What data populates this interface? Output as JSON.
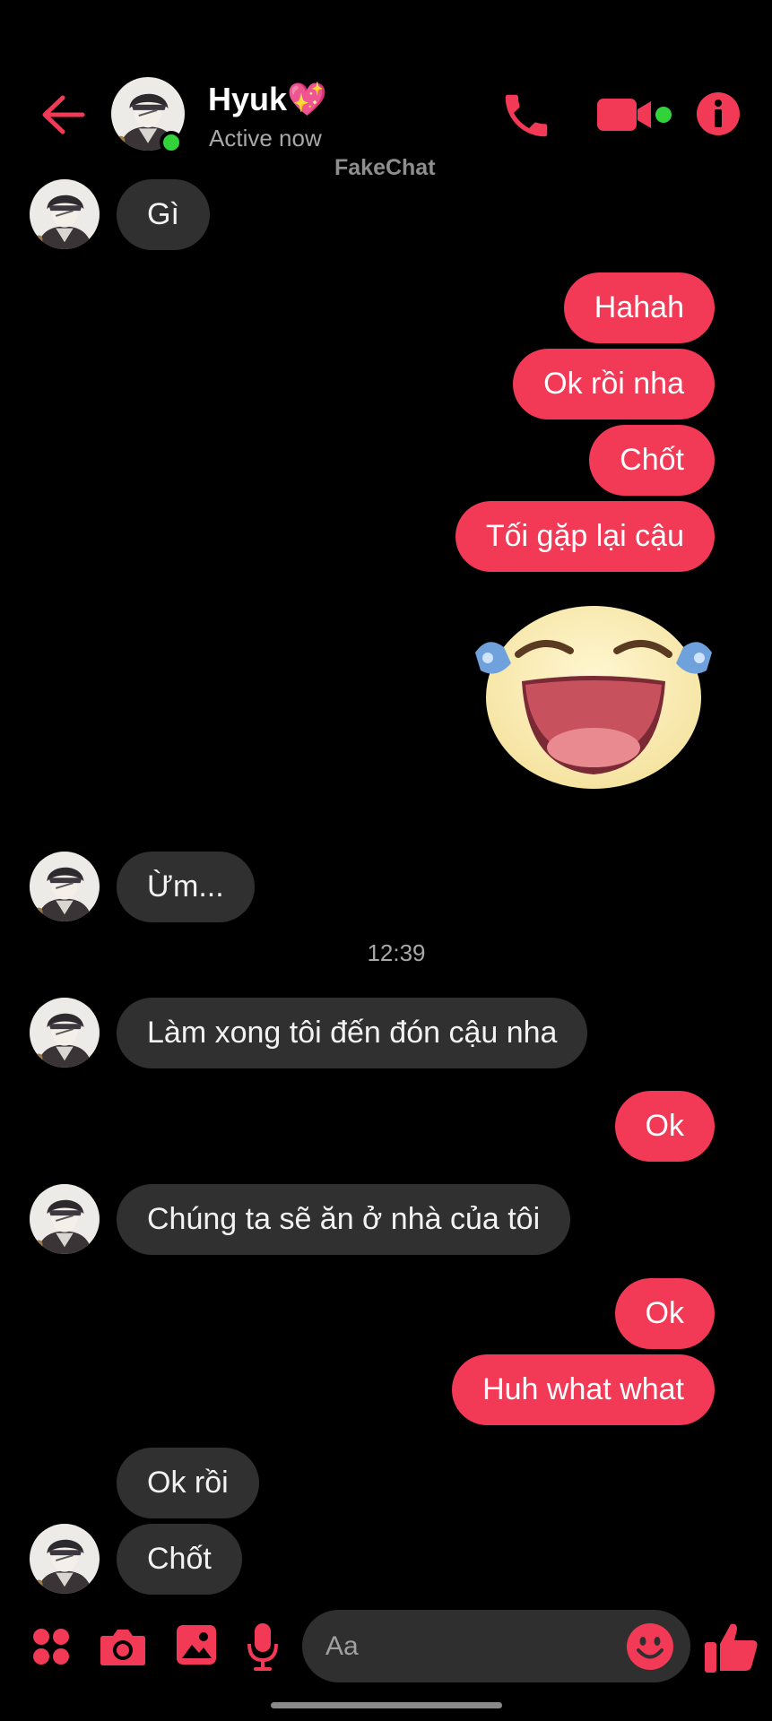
{
  "header": {
    "contact_name": "Hyuk💖",
    "status": "Active now",
    "watermark": "FakeChat"
  },
  "icons": {
    "back": "arrow-left-icon",
    "call": "phone-icon",
    "video": "video-camera-icon",
    "info": "info-icon",
    "apps": "four-dots-icon",
    "camera": "camera-icon",
    "gallery": "image-icon",
    "mic": "microphone-icon",
    "emoji": "smiley-icon",
    "like": "thumbs-up-icon"
  },
  "messages": [
    {
      "side": "in",
      "text": "Gì"
    },
    {
      "side": "out",
      "text": "Hahah"
    },
    {
      "side": "out",
      "text": "Ok rồi nha"
    },
    {
      "side": "out",
      "text": "Chốt"
    },
    {
      "side": "out",
      "text": "Tối gặp lại cậu"
    },
    {
      "side": "out",
      "sticker": "laughing-tears-sticker"
    },
    {
      "side": "in",
      "text": "Ừm..."
    },
    {
      "timestamp": "12:39"
    },
    {
      "side": "in",
      "text": "Làm xong tôi đến đón cậu nha"
    },
    {
      "side": "out",
      "text": "Ok"
    },
    {
      "side": "in",
      "text": "Chúng ta sẽ ăn ở nhà của tôi"
    },
    {
      "side": "out",
      "text": "Ok"
    },
    {
      "side": "out",
      "text": "Huh what what"
    },
    {
      "side": "in",
      "text": "Ok rồi"
    },
    {
      "side": "in",
      "text": "Chốt"
    }
  ],
  "composer": {
    "placeholder": "Aa",
    "value": ""
  },
  "colors": {
    "accent": "#f23a56",
    "incoming_bubble": "#303030",
    "background": "#000000",
    "online": "#31d23a"
  }
}
